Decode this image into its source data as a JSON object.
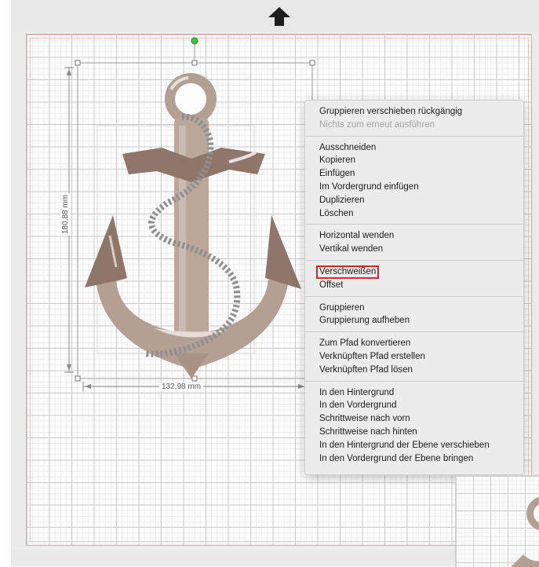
{
  "canvas": {
    "height_label": "180,88 mm",
    "width_label": "132,98 mm"
  },
  "icons": {
    "upload": "up-arrow-icon",
    "rotate_handle": "green-dot-icon"
  },
  "colors": {
    "anchor": "#b9a498",
    "anchor_dark": "#8e776a",
    "rotate_handle": "#33cc33",
    "highlight_border": "#e0252c",
    "canvas_border": "#e6a6a6"
  },
  "context_menu": {
    "sections": [
      {
        "items": [
          {
            "label": "Gruppieren verschieben rückgängig",
            "disabled": false
          },
          {
            "label": "Nichts zum erneut ausführen",
            "disabled": true
          }
        ]
      },
      {
        "items": [
          {
            "label": "Ausschneiden"
          },
          {
            "label": "Kopieren"
          },
          {
            "label": "Einfügen"
          },
          {
            "label": "Im Vordergrund einfügen"
          },
          {
            "label": "Duplizieren"
          },
          {
            "label": "Löschen"
          }
        ]
      },
      {
        "items": [
          {
            "label": "Horizontal wenden"
          },
          {
            "label": "Vertikal wenden"
          }
        ]
      },
      {
        "items": [
          {
            "label": "Verschweißen",
            "highlighted": true
          },
          {
            "label": "Offset"
          }
        ]
      },
      {
        "items": [
          {
            "label": "Gruppieren"
          },
          {
            "label": "Gruppierung aufheben"
          }
        ]
      },
      {
        "items": [
          {
            "label": "Zum Pfad konvertieren"
          },
          {
            "label": "Verknüpften Pfad erstellen"
          },
          {
            "label": "Verknüpften Pfad lösen"
          }
        ]
      },
      {
        "items": [
          {
            "label": "In den Hintergrund"
          },
          {
            "label": "In den Vordergrund"
          },
          {
            "label": "Schrittweise nach vorn"
          },
          {
            "label": "Schrittweise nach hinten"
          },
          {
            "label": "In den Hintergrund der Ebene verschieben"
          },
          {
            "label": "In den Vordergrund der Ebene bringen"
          }
        ]
      }
    ]
  }
}
